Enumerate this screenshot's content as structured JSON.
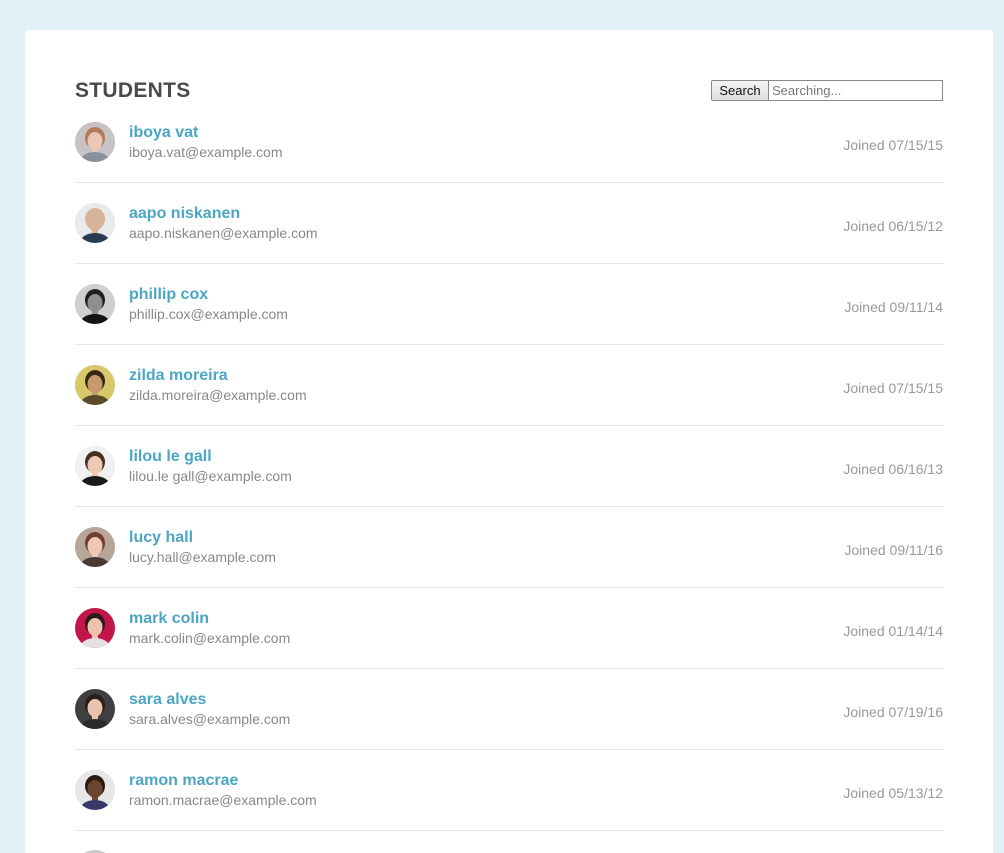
{
  "header": {
    "title": "STUDENTS",
    "search_button_label": "Search",
    "search_placeholder": "Searching..."
  },
  "students": [
    {
      "name": "iboya vat",
      "email": "iboya.vat@example.com",
      "joined": "Joined 07/15/15",
      "avatar": {
        "bg": "#c7c2c6",
        "skin": "#e9c6b5",
        "hair": "#b27a56",
        "shirt": "#8a8f9c"
      }
    },
    {
      "name": "aapo niskanen",
      "email": "aapo.niskanen@example.com",
      "joined": "Joined 06/15/12",
      "avatar": {
        "bg": "#e9eaec",
        "skin": "#d8b39b",
        "hair": "#d8b39b",
        "shirt": "#2b3b52"
      }
    },
    {
      "name": "phillip cox",
      "email": "phillip.cox@example.com",
      "joined": "Joined 09/11/14",
      "avatar": {
        "bg": "#cfcfcf",
        "skin": "#8f8f8f",
        "hair": "#1f1f1f",
        "shirt": "#141414"
      }
    },
    {
      "name": "zilda moreira",
      "email": "zilda.moreira@example.com",
      "joined": "Joined 07/15/15",
      "avatar": {
        "bg": "#d6c86b",
        "skin": "#c79a6d",
        "hair": "#3a2616",
        "shirt": "#5d4a2a"
      }
    },
    {
      "name": "lilou le gall",
      "email": "lilou.le gall@example.com",
      "joined": "Joined 06/16/13",
      "avatar": {
        "bg": "#f1f1f1",
        "skin": "#efc9b4",
        "hair": "#4a2f24",
        "shirt": "#1a1a1a"
      }
    },
    {
      "name": "lucy hall",
      "email": "lucy.hall@example.com",
      "joined": "Joined 09/11/16",
      "avatar": {
        "bg": "#b8a59a",
        "skin": "#edc8b5",
        "hair": "#6e3f2a",
        "shirt": "#4a3a34"
      }
    },
    {
      "name": "mark colin",
      "email": "mark.colin@example.com",
      "joined": "Joined 01/14/14",
      "avatar": {
        "bg": "#c3154a",
        "skin": "#efc2b0",
        "hair": "#2a1a1a",
        "shirt": "#e8e0e0"
      }
    },
    {
      "name": "sara alves",
      "email": "sara.alves@example.com",
      "joined": "Joined 07/19/16",
      "avatar": {
        "bg": "#3f3f3f",
        "skin": "#e9c3b0",
        "hair": "#2c1e1a",
        "shirt": "#2a2a2a"
      }
    },
    {
      "name": "ramon macrae",
      "email": "ramon.macrae@example.com",
      "joined": "Joined 05/13/12",
      "avatar": {
        "bg": "#e7e7e7",
        "skin": "#6b4530",
        "hair": "#2a1a12",
        "shirt": "#3b3868"
      }
    }
  ]
}
